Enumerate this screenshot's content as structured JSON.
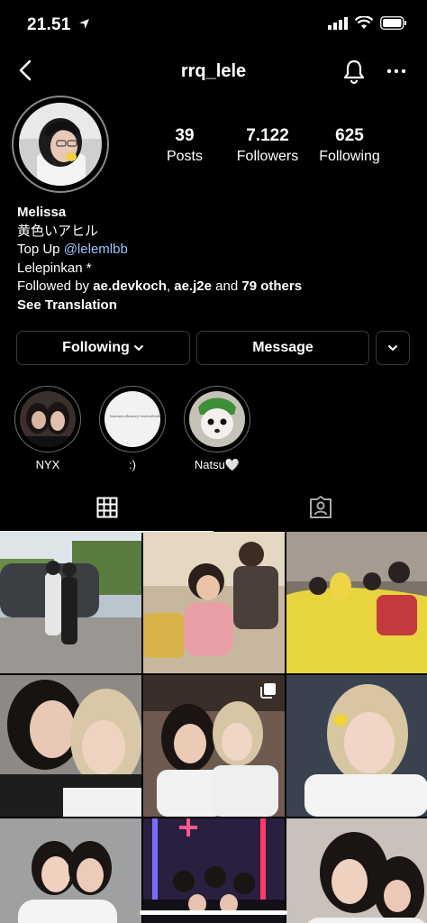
{
  "status_bar": {
    "time": "21.51",
    "location_icon": "location-arrow-icon",
    "signal_icon": "cellular-signal-icon",
    "wifi_icon": "wifi-icon",
    "battery_icon": "battery-icon"
  },
  "header": {
    "username": "rrq_lele",
    "back_icon": "chevron-left-icon",
    "bell_icon": "bell-icon",
    "more_icon": "ellipsis-icon"
  },
  "stats": [
    {
      "value": "39",
      "label": "Posts"
    },
    {
      "value": "7.122",
      "label": "Followers"
    },
    {
      "value": "625",
      "label": "Following"
    }
  ],
  "bio": {
    "name": "Melissa",
    "line1": "黄色いアヒル",
    "topup_prefix": "Top Up ",
    "topup_handle": "@lelemlbb",
    "line3": "Lelepinkan *",
    "followed_prefix": "Followed by ",
    "followed_user1": "ae.devkoch",
    "comma": ", ",
    "followed_user2": "ae.j2e",
    "and": " and ",
    "followed_others": "79 others",
    "see_translation": "See Translation"
  },
  "actions": {
    "following": "Following",
    "message": "Message"
  },
  "highlights": [
    {
      "label": "NYX"
    },
    {
      "label": ":)"
    },
    {
      "label": "Natsu🤍"
    }
  ],
  "highlight_card_text": "business|luxury+mens|look",
  "tabs": [
    {
      "icon": "grid-icon",
      "active": true
    },
    {
      "icon": "tagged-icon",
      "active": false
    }
  ],
  "colors": {
    "background": "#000000",
    "link": "#9fc1ff",
    "border": "#3a3a3a"
  }
}
